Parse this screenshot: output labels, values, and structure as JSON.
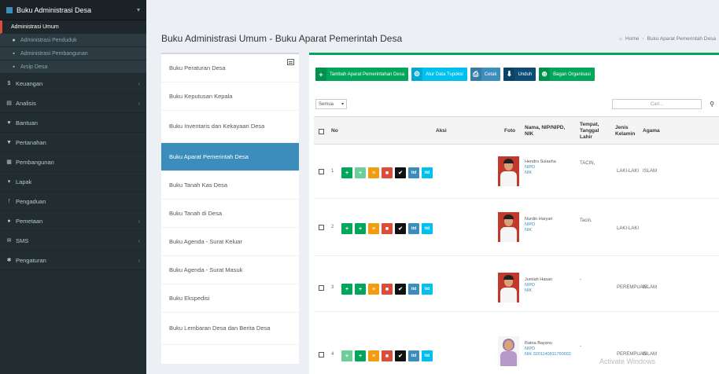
{
  "sidebar": {
    "header": "Buku Administrasi Desa",
    "sub_items": [
      "Administrasi Umum",
      "Administrasi Penduduk",
      "Administrasi Pembangunan",
      "Arsip Desa"
    ],
    "items": [
      "Keuangan",
      "Analisis",
      "Bantuan",
      "Pertanahan",
      "Pembangunan",
      "Lapak",
      "Pengaduan",
      "Pemetaan",
      "SMS",
      "Pengaturan"
    ]
  },
  "header": {
    "title": "Buku Administrasi Umum - Buku Aparat Pemerintah Desa",
    "breadcrumb": [
      "Home",
      "Buku Aparat Pemerintah Desa"
    ]
  },
  "leftmenu": [
    "Buku Peraturan Desa",
    "Buku Keputusan Kepala",
    "Buku Inventaris dan Kekayaan Desa",
    "Buku Aparat Pemerintah Desa",
    "Buku Tanah Kas Desa",
    "Buku Tanah di Desa",
    "Buku Agenda - Surat Keluar",
    "Buku Agenda - Surat Masuk",
    "Buku Ekspedisi",
    "Buku Lembaran Desa dan Berita Desa"
  ],
  "toolbar": {
    "add": "Tambah Aparat Pemerintahan Desa",
    "map": "Atur Data Tupoksi",
    "print": "Cetak",
    "download": "Unduh",
    "chart": "Bagan Organisasi"
  },
  "filter": {
    "value": "Semua"
  },
  "search": {
    "placeholder": "Cari..."
  },
  "table": {
    "headers": [
      "No",
      "Aksi",
      "Foto",
      "Nama, NIP/NIPD, NIK",
      "Tempat, Tanggal Lahir",
      "Jenis Kelamin",
      "Agama"
    ],
    "rows": [
      {
        "no": "1",
        "name": "Hendro Sulaeha",
        "nip": "NIPD",
        "nik": "NIK",
        "ttl": "TACIN,",
        "gender": "LAKI-LAKI",
        "religion": "ISLAM"
      },
      {
        "no": "2",
        "name": "Nurdin Haryari",
        "nip": "NIPD",
        "nik": "NIK",
        "ttl": "Tacin,",
        "gender": "LAKI-LAKI",
        "religion": ""
      },
      {
        "no": "3",
        "name": "Jumlah Hasan",
        "nip": "NIPD",
        "nik": "NIK",
        "ttl": "-",
        "gender": "PEREMPUAN",
        "religion": "ISLAM"
      },
      {
        "no": "4",
        "name": "Ratna Bayanu",
        "nip": "NIPD",
        "nik": "NIK 3201140811760002",
        "ttl": "-",
        "gender": "PEREMPUAN",
        "religion": "ISLAM"
      }
    ],
    "action_labels": [
      "+",
      "+",
      "≡",
      "■",
      "✔",
      "ttd",
      "ttd"
    ]
  },
  "watermark": "Activate Windows",
  "colors": {
    "sidebar": "#222d32",
    "accent": "#3c8dbc",
    "success": "#00a65a"
  }
}
